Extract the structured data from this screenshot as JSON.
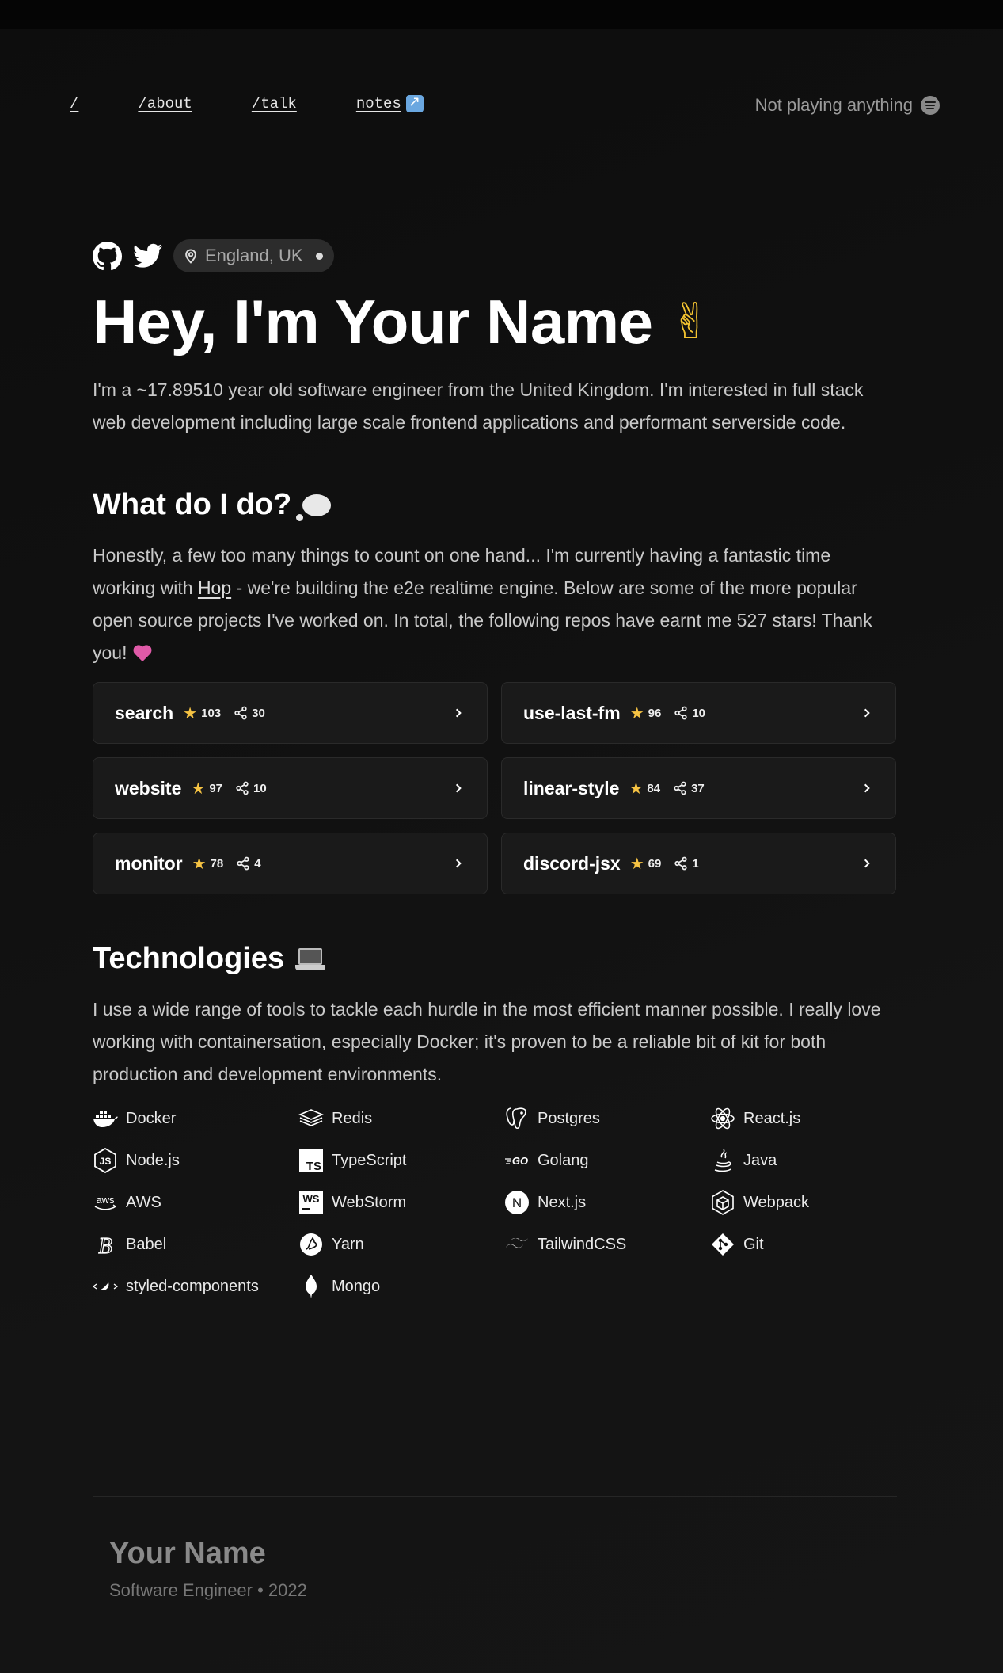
{
  "nav": {
    "items": [
      {
        "label": "/"
      },
      {
        "label": "/about"
      },
      {
        "label": "/talk"
      },
      {
        "label": "notes"
      }
    ]
  },
  "now_playing": {
    "text": "Not playing anything",
    "icon": "spotify-icon"
  },
  "hero": {
    "social": [
      "github-icon",
      "twitter-icon"
    ],
    "location": "England, UK",
    "title": "Hey, I'm Your Name",
    "title_emoji": "✌",
    "intro": "I'm a ~17.89510 year old software engineer from the United Kingdom. I'm interested in full stack web development including large scale frontend applications and performant serverside code."
  },
  "what": {
    "heading": "What do I do?",
    "text_before_link": "Honestly, a few too many things to count on one hand... I'm currently having a fantastic time working with ",
    "link": "Hop",
    "text_after_link": " - we're building the e2e realtime engine. Below are some of the more popular open source projects I've worked on. In total, the following repos have earnt me 527 stars! Thank you! "
  },
  "repos": [
    {
      "name": "search",
      "stars": "103",
      "forks": "30"
    },
    {
      "name": "use-last-fm",
      "stars": "96",
      "forks": "10"
    },
    {
      "name": "website",
      "stars": "97",
      "forks": "10"
    },
    {
      "name": "linear-style",
      "stars": "84",
      "forks": "37"
    },
    {
      "name": "monitor",
      "stars": "78",
      "forks": "4"
    },
    {
      "name": "discord-jsx",
      "stars": "69",
      "forks": "1"
    }
  ],
  "technologies": {
    "heading": "Technologies",
    "text": "I use a wide range of tools to tackle each hurdle in the most efficient manner possible. I really love working with containersation, especially Docker; it's proven to be a reliable bit of kit for both production and development environments.",
    "items": [
      {
        "label": "Docker",
        "icon": "docker-icon"
      },
      {
        "label": "Redis",
        "icon": "redis-icon"
      },
      {
        "label": "Postgres",
        "icon": "postgres-icon"
      },
      {
        "label": "React.js",
        "icon": "react-icon"
      },
      {
        "label": "Node.js",
        "icon": "nodejs-icon"
      },
      {
        "label": "TypeScript",
        "icon": "typescript-icon"
      },
      {
        "label": "Golang",
        "icon": "golang-icon"
      },
      {
        "label": "Java",
        "icon": "java-icon"
      },
      {
        "label": "AWS",
        "icon": "aws-icon"
      },
      {
        "label": "WebStorm",
        "icon": "webstorm-icon"
      },
      {
        "label": "Next.js",
        "icon": "nextjs-icon"
      },
      {
        "label": "Webpack",
        "icon": "webpack-icon"
      },
      {
        "label": "Babel",
        "icon": "babel-icon"
      },
      {
        "label": "Yarn",
        "icon": "yarn-icon"
      },
      {
        "label": "TailwindCSS",
        "icon": "tailwind-icon"
      },
      {
        "label": "Git",
        "icon": "git-icon"
      },
      {
        "label": "styled-components",
        "icon": "styled-components-icon"
      },
      {
        "label": "Mongo",
        "icon": "mongo-icon"
      }
    ],
    "icon_text": {
      "ts": "TS",
      "ws": "WS",
      "go": "GO",
      "aws": "aws",
      "babel": "B",
      "next": "N"
    }
  },
  "footer": {
    "name": "Your Name",
    "sub": "Software Engineer • 2022"
  },
  "colors": {
    "background": "#0d0d0d",
    "card": "#1a1a1a",
    "text_muted": "#c9c9c9",
    "star": "#f6c343"
  }
}
